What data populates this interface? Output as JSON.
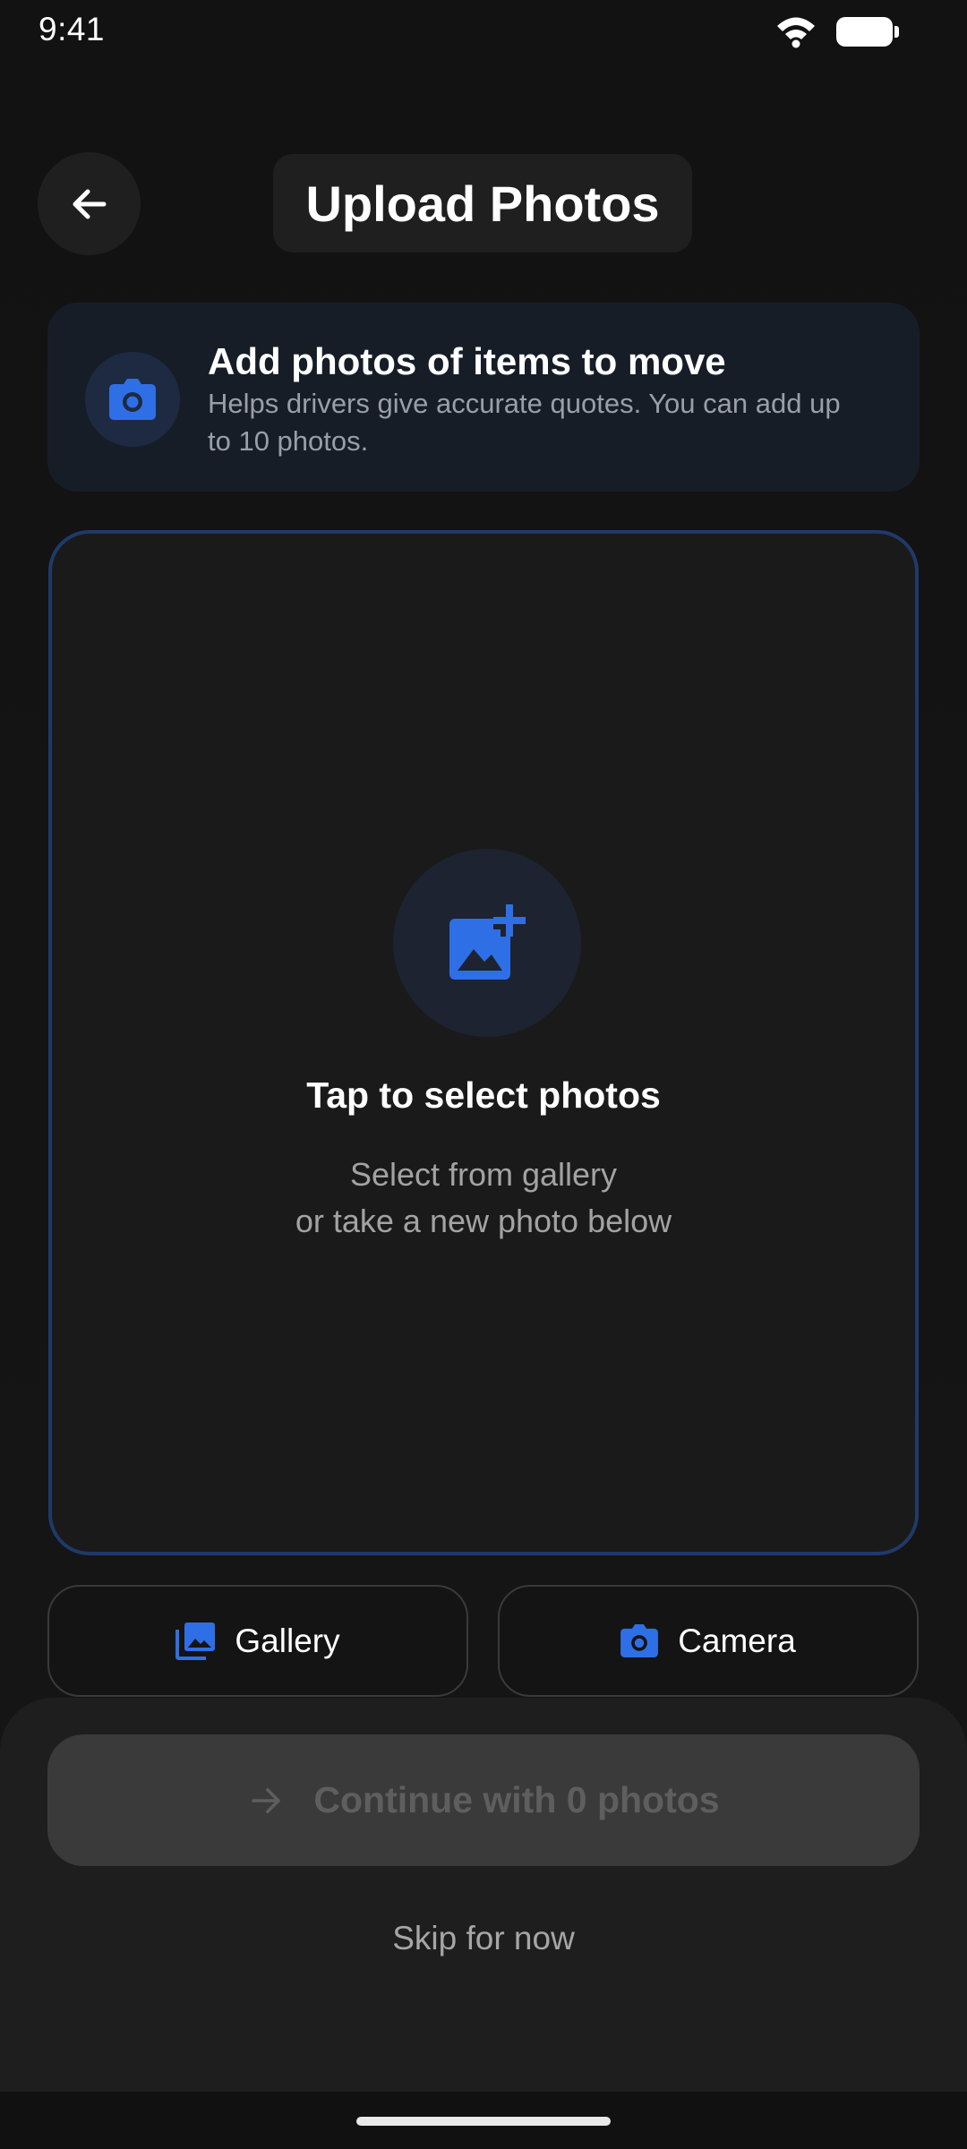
{
  "status_bar": {
    "time": "9:41",
    "wifi_icon": "wifi-icon",
    "battery_icon": "battery-icon"
  },
  "header": {
    "back_icon": "arrow-left-icon",
    "title": "Upload Photos"
  },
  "info_card": {
    "icon": "camera-icon",
    "title": "Add photos of items to move",
    "description": "Helps drivers give accurate quotes. You can add up to 10 photos."
  },
  "drop_zone": {
    "icon": "add-photo-icon",
    "title": "Tap to select photos",
    "subtitle_line1": "Select from gallery",
    "subtitle_line2": "or take a new photo below"
  },
  "source_buttons": {
    "gallery": {
      "icon": "gallery-icon",
      "label": "Gallery"
    },
    "camera": {
      "icon": "camera-icon",
      "label": "Camera"
    }
  },
  "footer": {
    "continue_icon": "arrow-right-icon",
    "continue_label": "Continue with 0 photos",
    "skip_label": "Skip for now"
  },
  "colors": {
    "accent": "#2f6fe6",
    "background": "#131313",
    "disabled_text": "#5e5e5e"
  }
}
